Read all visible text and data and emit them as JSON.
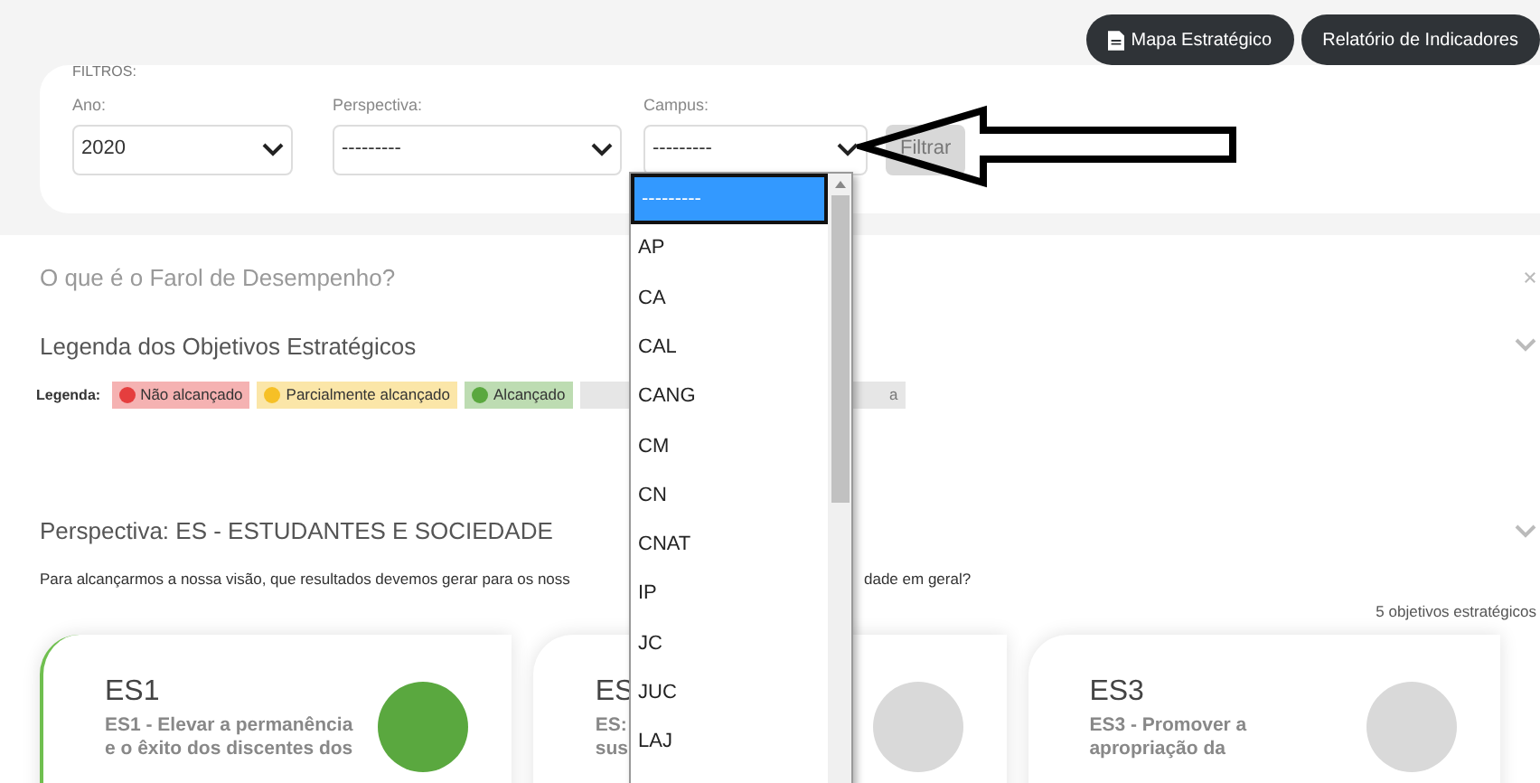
{
  "top_buttons": [
    {
      "label": "Mapa Estratégico",
      "kind": "icon"
    },
    {
      "label": "Relatório de Indicadores",
      "kind": "plain"
    }
  ],
  "filters": {
    "title": "FILTROS:",
    "fields": [
      {
        "label": "Ano:",
        "value": "2020"
      },
      {
        "label": "Perspectiva:",
        "value": "---------"
      },
      {
        "label": "Campus:",
        "value": "---------"
      }
    ],
    "button": "Filtrar"
  },
  "campus_options": [
    {
      "label": "---------",
      "selected": true
    },
    {
      "label": "AP",
      "selected": false
    },
    {
      "label": "CA",
      "selected": false
    },
    {
      "label": "CAL",
      "selected": false
    },
    {
      "label": "CANG",
      "selected": false
    },
    {
      "label": "CM",
      "selected": false
    },
    {
      "label": "CN",
      "selected": false
    },
    {
      "label": "CNAT",
      "selected": false
    },
    {
      "label": "IP",
      "selected": false
    },
    {
      "label": "JC",
      "selected": false
    },
    {
      "label": "JUC",
      "selected": false
    },
    {
      "label": "LAJ",
      "selected": false
    }
  ],
  "faq_title": "O que é o Farol de Desempenho?",
  "legend_title": "Legenda dos Objetivos Estratégicos",
  "legend": {
    "label": "Legenda:",
    "items": [
      {
        "label": "Não alcançado",
        "color": "#e53e3e"
      },
      {
        "label": "Parcialmente alcançado",
        "color": "#f6c026"
      },
      {
        "label": "Alcançado",
        "color": "#5aa83f"
      },
      {
        "label": "a",
        "color": "#e6e6e6"
      }
    ]
  },
  "perspective": {
    "title": "Perspectiva: ES - ESTUDANTES E SOCIEDADE",
    "question_parts": [
      "Para alcançarmos a nossa visão, que resultados devemos gerar para os noss",
      "dade em geral?"
    ],
    "count": "5 objetivos estratégicos",
    "cards": [
      {
        "code": "ES1",
        "lines": [
          "ES1 - Elevar a permanência",
          "e o êxito dos discentes dos"
        ],
        "color": "#5aa83f"
      },
      {
        "code": "ES",
        "lines": [
          "ES:",
          "sus"
        ],
        "color": "#d9d9d9"
      },
      {
        "code": "ES3",
        "lines": [
          "ES3 - Promover a",
          "apropriação da"
        ],
        "color": "#d9d9d9"
      }
    ]
  }
}
